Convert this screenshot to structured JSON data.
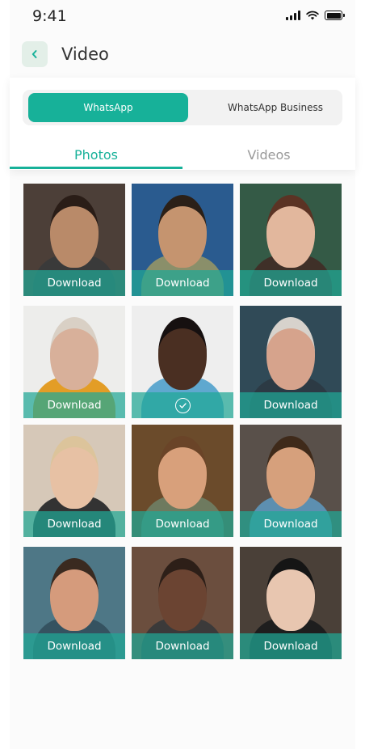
{
  "status_bar": {
    "time": "9:41"
  },
  "header": {
    "title": "Video"
  },
  "source_switch": {
    "options": [
      "WhatsApp",
      "WhatsApp Business"
    ],
    "selected": "WhatsApp"
  },
  "tabs": {
    "items": [
      "Photos",
      "Videos"
    ],
    "selected": "Photos"
  },
  "accent_color": "#17b199",
  "grid": {
    "download_label": "Download",
    "items": [
      {
        "state": "download",
        "bg": "#4c3f38",
        "skin": "#b98a69",
        "shirt": "#3a3a3a",
        "hair": "#2a1d17"
      },
      {
        "state": "download",
        "bg": "#2a5b8f",
        "skin": "#c5946f",
        "shirt": "#8a8f6a",
        "hair": "#2b2018"
      },
      {
        "state": "download",
        "bg": "#345a46",
        "skin": "#e2b79d",
        "shirt": "#3f3028",
        "hair": "#5b3324"
      },
      {
        "state": "download",
        "bg": "#ededeb",
        "skin": "#d8b09a",
        "shirt": "#e39d26",
        "hair": "#d9d0c5"
      },
      {
        "state": "selected",
        "bg": "#eeeeee",
        "skin": "#4a2f22",
        "shirt": "#5fa8cf",
        "hair": "#161010"
      },
      {
        "state": "download",
        "bg": "#304a57",
        "skin": "#d6a38c",
        "shirt": "#2c3a44",
        "hair": "#d7d2cc"
      },
      {
        "state": "download",
        "bg": "#d6c8b8",
        "skin": "#e7c1a4",
        "shirt": "#333333",
        "hair": "#dcc49b"
      },
      {
        "state": "download",
        "bg": "#6b4b2b",
        "skin": "#d8a07b",
        "shirt": "#6e7a5f",
        "hair": "#6a4428"
      },
      {
        "state": "download",
        "bg": "#59504a",
        "skin": "#d6a07c",
        "shirt": "#5d8fb0",
        "hair": "#3f2a1a"
      },
      {
        "state": "download",
        "bg": "#4e7786",
        "skin": "#d59b7c",
        "shirt": "#355260",
        "hair": "#3a2a20"
      },
      {
        "state": "download",
        "bg": "#6b4e3e",
        "skin": "#6b4432",
        "shirt": "#3b3a3a",
        "hair": "#2d1f18"
      },
      {
        "state": "download",
        "bg": "#4a4038",
        "skin": "#e8c6b0",
        "shirt": "#1e1e1e",
        "hair": "#151515"
      }
    ]
  }
}
